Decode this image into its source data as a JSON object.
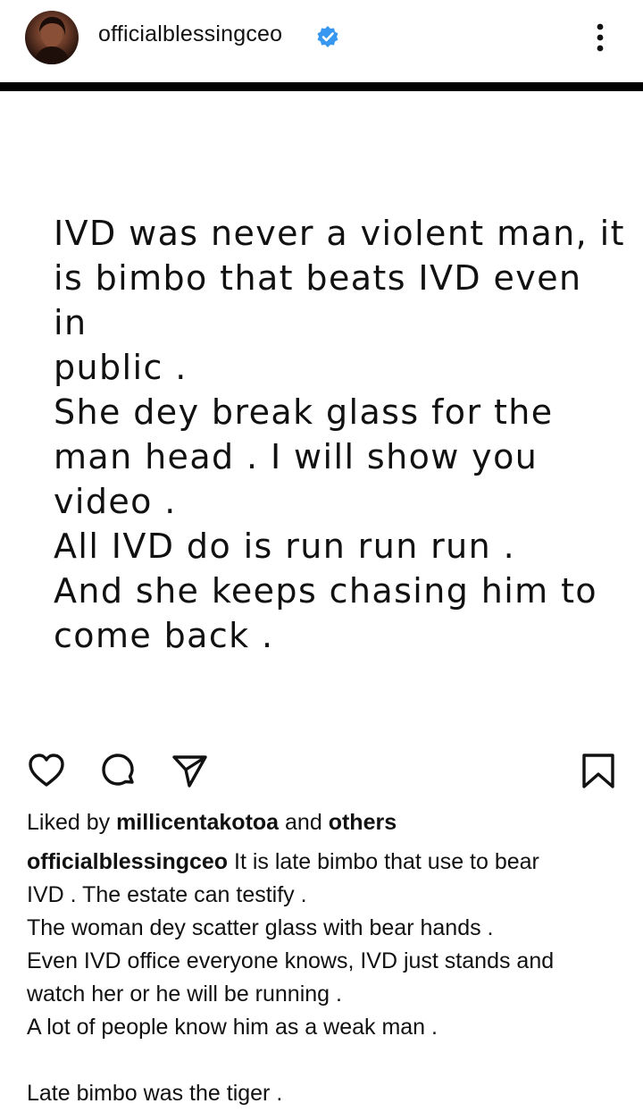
{
  "post": {
    "username": "officialblessingceo",
    "image_text": [
      "IVD was never a violent man, it",
      "is bimbo that beats IVD even in",
      "public .",
      "She dey break glass for the",
      "man head . I will show you",
      "video .",
      "All IVD do is run run run .",
      "And she keeps chasing him to",
      "come back ."
    ]
  },
  "likes": {
    "prefix": "Liked by",
    "user": "millicentakotoa",
    "and": "and",
    "others": "others"
  },
  "caption": {
    "username": "officialblessingceo",
    "first_line": "It is late bimbo that use to bear",
    "lines": [
      "IVD . The estate can testify .",
      "The woman dey scatter glass with bear hands .",
      "Even IVD office everyone knows, IVD just stands and",
      "watch her or he will be running .",
      "A lot of people know him as a weak man ."
    ],
    "last_line": "Late bimbo was the tiger ."
  },
  "icons": {
    "avatar": "profile-photo",
    "verified": "verified-badge-icon",
    "more": "more-options-icon",
    "like": "heart-icon",
    "comment": "comment-icon",
    "share": "share-icon",
    "save": "bookmark-icon"
  },
  "colors": {
    "verified": "#3897f0",
    "text": "#111111",
    "background": "#ffffff"
  }
}
